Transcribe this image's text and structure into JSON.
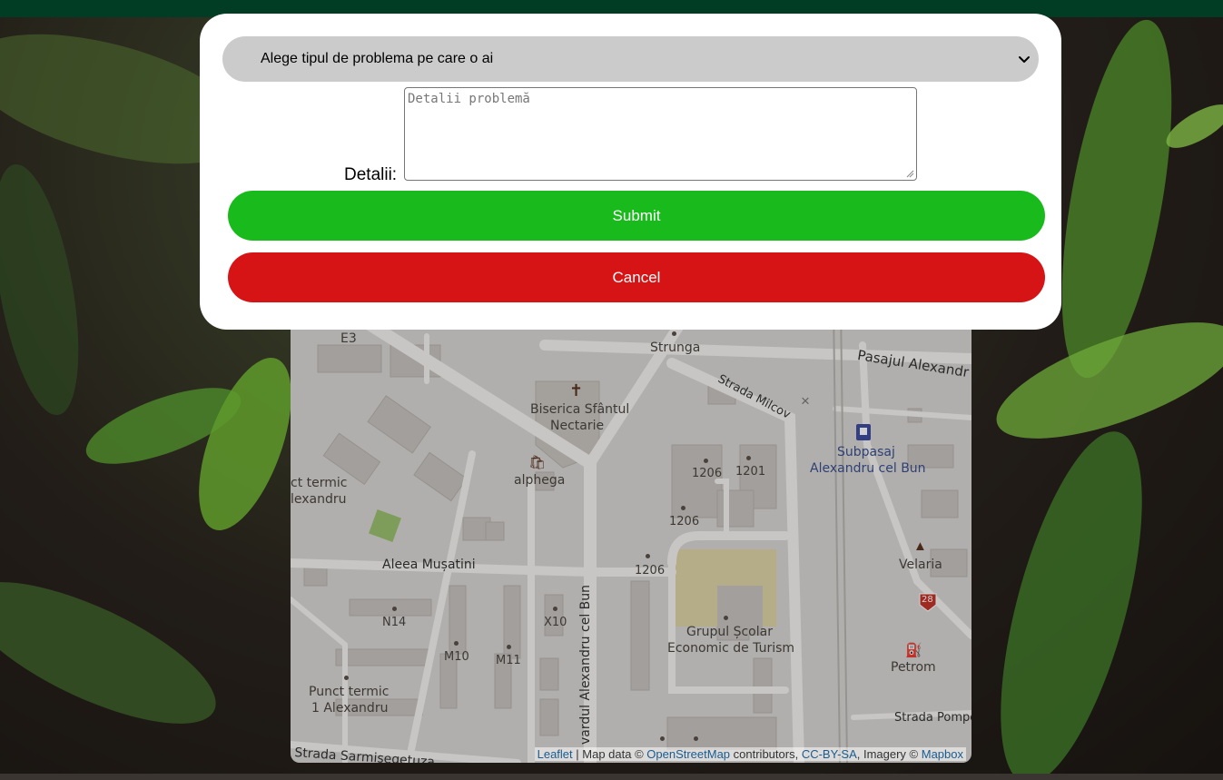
{
  "form": {
    "select_value": "Alege tipul de problema pe care o ai",
    "details_label": "Detalii:",
    "details_placeholder": "Detalii problemă",
    "submit_label": "Submit",
    "cancel_label": "Cancel"
  },
  "map": {
    "labels": {
      "e3": "E3",
      "strunga": "Strunga",
      "pasajul": "Pasajul Alexandr",
      "biserica_1": "Biserica Sfântul",
      "biserica_2": "Nectarie",
      "strada_milcov": "Strada Milcov",
      "subpasaj_1": "Subpasaj",
      "subpasaj_2": "Alexandru cel Bun",
      "punct_termic_top_1": "ct termic",
      "punct_termic_top_2": "lexandru",
      "alphega": "alphega",
      "n1206a": "1206",
      "n1201": "1201",
      "n1206b": "1206",
      "n1206c": "1206",
      "velaria": "Velaria",
      "aleea_musatini": "Aleea Mușatini",
      "n14": "N14",
      "x10": "X10",
      "bulevardul": "vardul Alexandru cel Bun",
      "grupul_1": "Grupul Școlar",
      "grupul_2": "Economic de Turism",
      "m10": "M10",
      "m11": "M11",
      "petrom": "Petrom",
      "punct_termic_bot_1": "Punct termic",
      "punct_termic_bot_2": "1 Alexandru",
      "strada_pompe": "Strada Pompe",
      "strada_sarmisegetuza": "Strada Sarmisegetuza",
      "route_28": "28"
    },
    "attribution": {
      "leaflet": "Leaflet",
      "sep": " | Map data © ",
      "osm": "OpenStreetMap",
      "contributors": " contributors, ",
      "ccbysa": "CC-BY-SA",
      "imagery": ", Imagery © ",
      "mapbox": "Mapbox"
    }
  },
  "colors": {
    "header": "#003d24",
    "submit": "#19bb1c",
    "cancel": "#d61416",
    "select_bg": "#cbcbcb"
  },
  "icons": {
    "select_chevron": "chevron-down-icon",
    "church": "cross-icon",
    "shop": "basket-icon",
    "subway": "subway-icon",
    "velaria": "lamp-icon",
    "fuel": "fuel-icon"
  }
}
